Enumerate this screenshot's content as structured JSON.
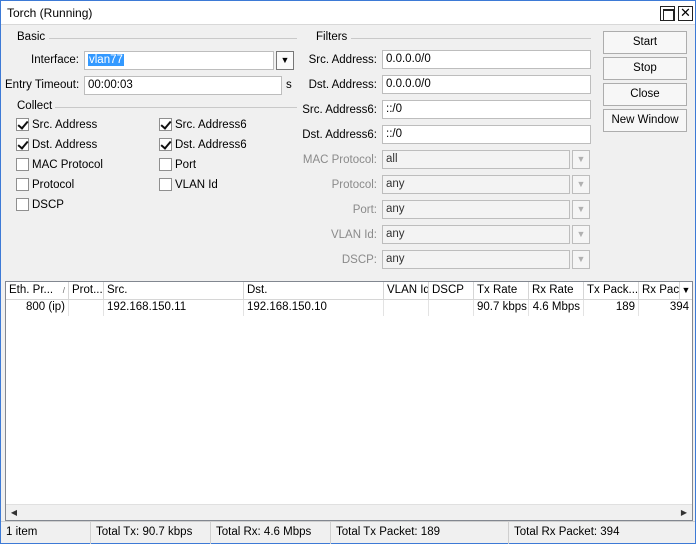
{
  "window": {
    "title": "Torch (Running)",
    "max_icon": "maximize-icon",
    "close_icon": "close-icon",
    "close_glyph": "✕"
  },
  "basic": {
    "section_label": "Basic",
    "interface_label": "Interface:",
    "interface_value": "vlan77",
    "entry_timeout_label": "Entry Timeout:",
    "entry_timeout_value": "00:00:03",
    "entry_timeout_unit": "s"
  },
  "collect": {
    "section_label": "Collect",
    "items": [
      {
        "label": "Src. Address",
        "checked": true
      },
      {
        "label": "Src. Address6",
        "checked": true
      },
      {
        "label": "Dst. Address",
        "checked": true
      },
      {
        "label": "Dst. Address6",
        "checked": true
      },
      {
        "label": "MAC Protocol",
        "checked": false
      },
      {
        "label": "Port",
        "checked": false
      },
      {
        "label": "Protocol",
        "checked": false
      },
      {
        "label": "VLAN Id",
        "checked": false
      },
      {
        "label": "DSCP",
        "checked": false
      }
    ]
  },
  "filters": {
    "section_label": "Filters",
    "src_address": {
      "label": "Src. Address:",
      "value": "0.0.0.0/0"
    },
    "dst_address": {
      "label": "Dst. Address:",
      "value": "0.0.0.0/0"
    },
    "src_address6": {
      "label": "Src. Address6:",
      "value": "::/0"
    },
    "dst_address6": {
      "label": "Dst. Address6:",
      "value": "::/0"
    },
    "mac_protocol": {
      "label": "MAC Protocol:",
      "value": "all"
    },
    "protocol": {
      "label": "Protocol:",
      "value": "any"
    },
    "port": {
      "label": "Port:",
      "value": "any"
    },
    "vlan_id": {
      "label": "VLAN Id:",
      "value": "any"
    },
    "dscp": {
      "label": "DSCP:",
      "value": "any"
    }
  },
  "buttons": {
    "start": "Start",
    "stop": "Stop",
    "close": "Close",
    "new_window": "New Window"
  },
  "table": {
    "columns": [
      "Eth. Pr...",
      "Prot...",
      "Src.",
      "Dst.",
      "VLAN Id",
      "DSCP",
      "Tx Rate",
      "Rx Rate",
      "Tx Pack...",
      "Rx Pac"
    ],
    "sort_glyph": "/",
    "menu_glyph": "▼",
    "rows": [
      [
        "800 (ip)",
        "",
        "192.168.150.11",
        "192.168.150.10",
        "",
        "",
        "90.7 kbps",
        "4.6 Mbps",
        "189",
        "394"
      ]
    ]
  },
  "scrollbar": {
    "left_glyph": "◀",
    "right_glyph": "▶"
  },
  "status": {
    "items": "1 item",
    "total_tx": "Total Tx: 90.7 kbps",
    "total_rx": "Total Rx: 4.6 Mbps",
    "total_tx_packet": "Total Tx Packet: 189",
    "total_rx_packet": "Total Rx Packet: 394"
  },
  "colors": {
    "accent": "#3d7ad6",
    "selection": "#3399ff"
  }
}
